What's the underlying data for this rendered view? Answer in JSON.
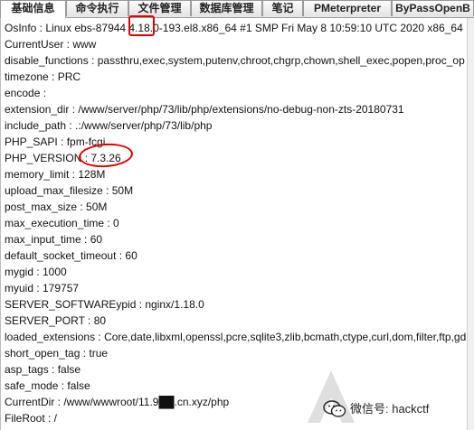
{
  "tabs": [
    {
      "label": "基础信息",
      "active": true
    },
    {
      "label": "命令执行",
      "active": false
    },
    {
      "label": "文件管理",
      "active": false
    },
    {
      "label": "数据库管理",
      "active": false
    },
    {
      "label": "笔记",
      "active": false
    },
    {
      "label": "PMeterpreter",
      "active": false
    },
    {
      "label": "ByPassOpenB",
      "active": false
    }
  ],
  "info_lines": [
    "OsInfo : Linux ebs-87944 4.18.0-193.el8.x86_64 #1 SMP Fri May 8 10:59:10 UTC 2020 x86_64",
    "CurrentUser : www",
    "disable_functions : passthru,exec,system,putenv,chroot,chgrp,chown,shell_exec,popen,proc_op",
    "timezone : PRC",
    "encode :",
    "extension_dir : /www/server/php/73/lib/php/extensions/no-debug-non-zts-20180731",
    "include_path : .:/www/server/php/73/lib/php",
    "PHP_SAPI : fpm-fcgi",
    "PHP_VERSION : 7.3.26",
    "memory_limit : 128M",
    "upload_max_filesize : 50M",
    "post_max_size : 50M",
    "max_execution_time : 0",
    "max_input_time : 60",
    "default_socket_timeout : 60",
    "mygid : 1000",
    "myuid : 179757",
    "SERVER_SOFTWAREypid : nginx/1.18.0",
    "SERVER_PORT : 80",
    "loaded_extensions : Core,date,libxml,openssl,pcre,sqlite3,zlib,bcmath,ctype,curl,dom,filter,ftp,gd",
    "short_open_tag : true",
    "asp_tags : false",
    "safe_mode : false",
    "CurrentDir : /www/wwwroot/11.9██.cn.xyz/php",
    "FileRoot : /"
  ],
  "watermark": {
    "text": "微信号: hackctf",
    "icon": "wechat-icon"
  },
  "colors": {
    "highlight": "#e00000"
  }
}
